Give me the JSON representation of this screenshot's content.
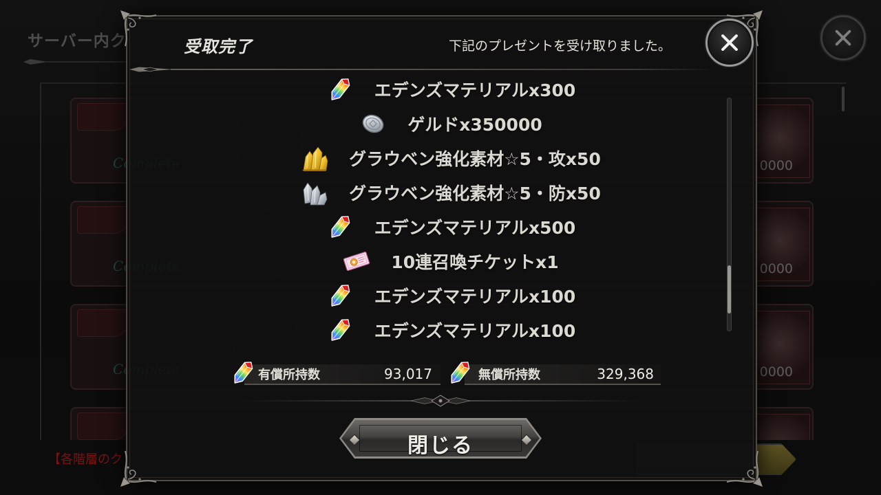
{
  "background": {
    "screen_title": "サーバー内ク",
    "close_icon": "close-icon",
    "rows": [
      {
        "status": "Complete",
        "amount": "0000"
      },
      {
        "status": "Complete",
        "amount": "0000"
      },
      {
        "status": "Complete",
        "amount": "0000"
      }
    ],
    "footer_notice": "【各階層のク"
  },
  "dialog": {
    "title": "受取完了",
    "message": "下記のプレゼントを受け取りました。",
    "close_icon": "close-icon",
    "items": [
      {
        "icon": "eden-material-icon",
        "label": "エデンズマテリアルx300"
      },
      {
        "icon": "geld-coin-icon",
        "label": "ゲルドx350000"
      },
      {
        "icon": "gold-ore-icon",
        "label": "グラウベン強化素材☆5・攻x50"
      },
      {
        "icon": "silver-ore-icon",
        "label": "グラウベン強化素材☆5・防x50"
      },
      {
        "icon": "eden-material-icon",
        "label": "エデンズマテリアルx500"
      },
      {
        "icon": "summon-ticket-icon",
        "label": "10連召喚チケットx1"
      },
      {
        "icon": "eden-material-icon",
        "label": "エデンズマテリアルx100"
      },
      {
        "icon": "eden-material-icon",
        "label": "エデンズマテリアルx100"
      }
    ],
    "balances": [
      {
        "icon": "eden-material-icon",
        "label": "有償所持数",
        "value": "93,017"
      },
      {
        "icon": "eden-material-icon",
        "label": "無償所持数",
        "value": "329,368"
      }
    ],
    "close_button_label": "閉じる"
  },
  "colors": {
    "dialog_background": "#111111",
    "dialog_border": "#4f4944",
    "text_primary": "#e6e2dc",
    "complete_status": "#1e4b45",
    "notice_red": "#7d1212",
    "button_face": "#44423f"
  }
}
